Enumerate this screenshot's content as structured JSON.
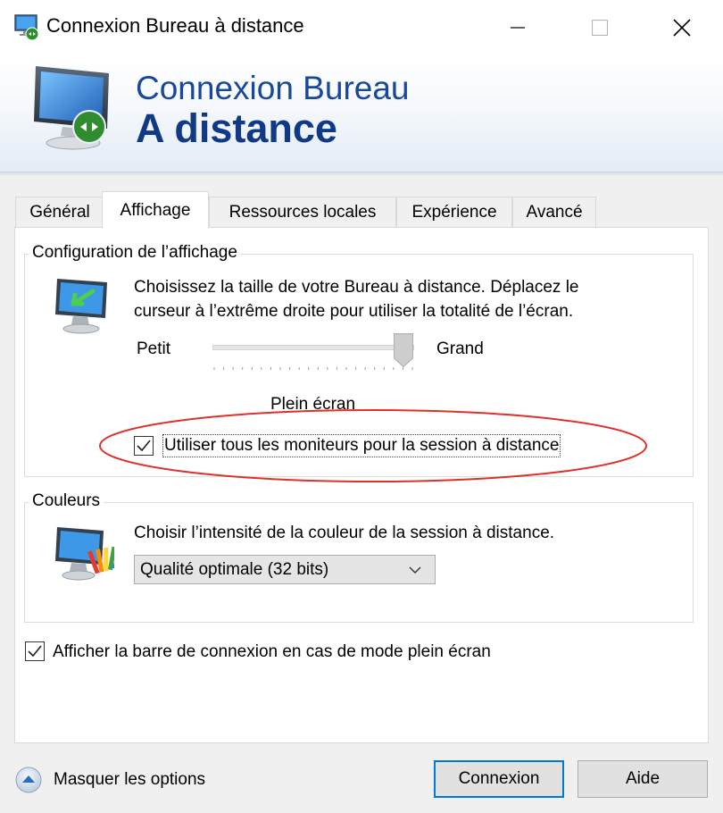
{
  "window": {
    "title": "Connexion Bureau à distance",
    "controls": {
      "minimize": "—",
      "maximize": "☐",
      "close": "✕"
    }
  },
  "banner": {
    "line1": "Connexion Bureau",
    "line2": "A distance"
  },
  "tabs": [
    {
      "label": "Général",
      "active": false
    },
    {
      "label": "Affichage",
      "active": true
    },
    {
      "label": "Ressources locales",
      "active": false
    },
    {
      "label": "Expérience",
      "active": false
    },
    {
      "label": "Avancé",
      "active": false
    }
  ],
  "display_config": {
    "group_title": "Configuration de l’affichage",
    "description_line1": "Choisissez la taille de votre Bureau à distance. Déplacez le",
    "description_line2": "curseur à l’extrême droite pour utiliser la totalité de l’écran.",
    "slider_min_label": "Petit",
    "slider_max_label": "Grand",
    "slider_level": 1.0,
    "slider_value_label": "Plein écran",
    "use_all_monitors": {
      "label": "Utiliser tous les moniteurs pour la session à distance",
      "checked": true
    }
  },
  "colors": {
    "group_title": "Couleurs",
    "description": "Choisir l’intensité de la couleur de la session à distance.",
    "selected_option": "Qualité optimale (32 bits)"
  },
  "connection_bar": {
    "label": "Afficher la barre de connexion en cas de mode plein écran",
    "checked": true
  },
  "footer": {
    "toggle_options_label": "Masquer les options",
    "connect_button": "Connexion",
    "help_button": "Aide"
  },
  "accent_colors": {
    "banner_text": "#17489c",
    "focus_border": "#0078d7",
    "annotation": "#e0302a"
  },
  "icons": [
    "remote-desktop-icon",
    "monitor-arrow-icon",
    "monitor-palette-icon",
    "chevron-down-icon",
    "collapse-arrow-icon",
    "checkmark-icon"
  ]
}
